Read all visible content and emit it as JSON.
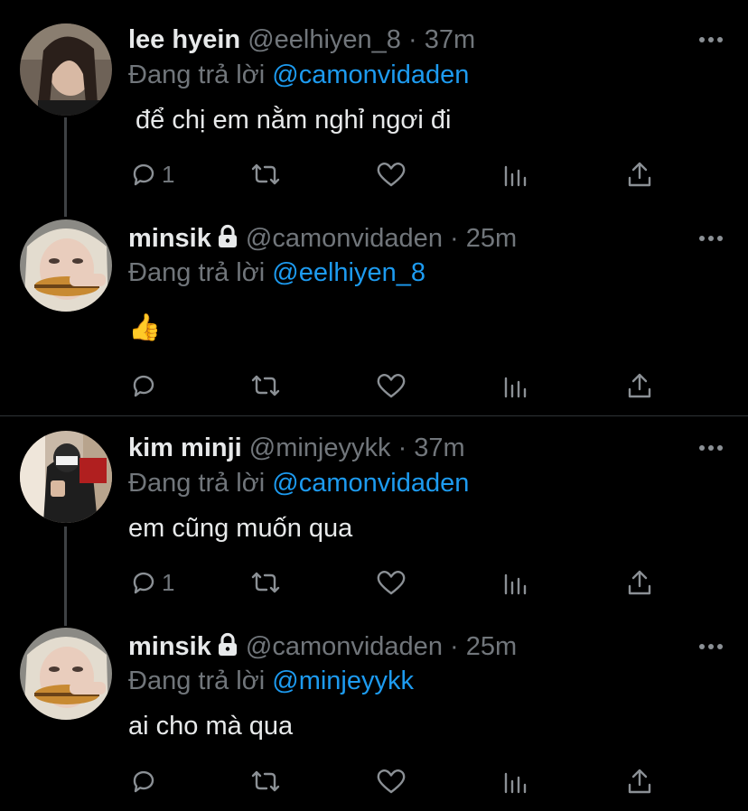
{
  "colors": {
    "background": "#000000",
    "link": "#1d9bf0",
    "muted": "#71767b",
    "text": "#e7e9ea"
  },
  "tweets": [
    {
      "name": "lee hyein",
      "handle": "@eelhiyen_8",
      "time": "· 37m",
      "locked": false,
      "reply_prefix": "Đang trả lời",
      "reply_to": "@camonvidaden",
      "text": "để chị em nằm nghỉ ngơi đi",
      "reply_count": "1"
    },
    {
      "name": "minsik",
      "handle": "@camonvidaden",
      "time": "· 25m",
      "locked": true,
      "reply_prefix": "Đang trả lời",
      "reply_to": "@eelhiyen_8",
      "text": "👍",
      "reply_count": ""
    },
    {
      "name": "kim minji",
      "handle": "@minjeyykk",
      "time": "· 37m",
      "locked": false,
      "reply_prefix": "Đang trả lời",
      "reply_to": "@camonvidaden",
      "text": "em cũng muốn qua",
      "reply_count": "1"
    },
    {
      "name": "minsik",
      "handle": "@camonvidaden",
      "time": "· 25m",
      "locked": true,
      "reply_prefix": "Đang trả lời",
      "reply_to": "@minjeyykk",
      "text": "ai cho mà qua",
      "reply_count": ""
    }
  ],
  "icons": {
    "reply": "reply-icon",
    "retweet": "retweet-icon",
    "like": "heart-icon",
    "views": "analytics-icon",
    "share": "share-icon",
    "more": "more-icon",
    "lock": "lock-icon"
  }
}
